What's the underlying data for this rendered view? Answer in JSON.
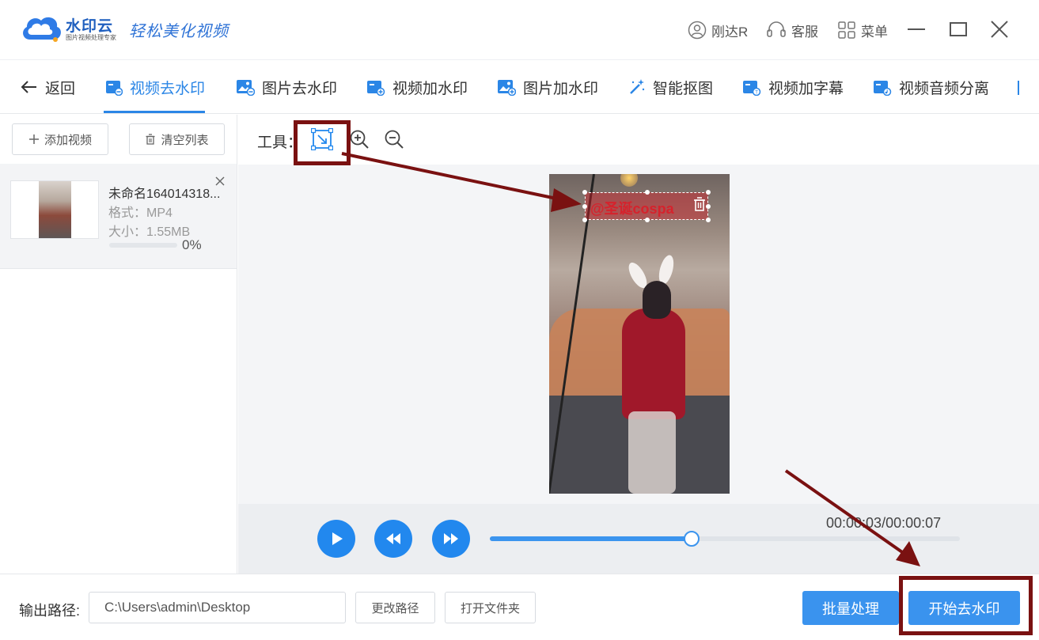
{
  "app": {
    "brand_name": "水印云",
    "brand_sub": "图片视频处理专家",
    "slogan": "轻松美化视频",
    "user_name": "刚达R",
    "service_label": "客服",
    "menu_label": "菜单"
  },
  "nav": {
    "back_label": "返回",
    "tabs": [
      {
        "label": "视频去水印",
        "icon": "video-icon",
        "active": true
      },
      {
        "label": "图片去水印",
        "icon": "image-icon",
        "active": false
      },
      {
        "label": "视频加水印",
        "icon": "video-add-icon",
        "active": false
      },
      {
        "label": "图片加水印",
        "icon": "image-add-icon",
        "active": false
      },
      {
        "label": "智能抠图",
        "icon": "magic-wand-icon",
        "active": false
      },
      {
        "label": "视频加字幕",
        "icon": "video-subtitle-icon",
        "active": false
      },
      {
        "label": "视频音频分离",
        "icon": "video-audio-icon",
        "active": false
      }
    ]
  },
  "left": {
    "add_video_label": "添加视频",
    "clear_list_label": "清空列表",
    "file": {
      "name": "未命名164014318...",
      "format": "格式：MP4",
      "size": "大小：1.55MB",
      "progress_text": "0%",
      "progress": 0
    }
  },
  "tools": {
    "label": "工具：",
    "select_tool_icon": "select-area-icon",
    "zoom_in_icon": "zoom-in-icon",
    "zoom_out_icon": "zoom-out-icon"
  },
  "preview": {
    "watermark_text": "@圣诞cospa"
  },
  "player": {
    "time_text": "00:00:03/00:00:07",
    "current_seconds": 3,
    "total_seconds": 7
  },
  "bottom": {
    "output_label": "输出路径:",
    "output_path": "C:\\Users\\admin\\Desktop",
    "change_path_label": "更改路径",
    "open_folder_label": "打开文件夹",
    "batch_label": "批量处理",
    "start_label": "开始去水印"
  },
  "colors": {
    "accent": "#2b86e6",
    "primary_button": "#3a93ee",
    "annotation": "#7a1111"
  }
}
